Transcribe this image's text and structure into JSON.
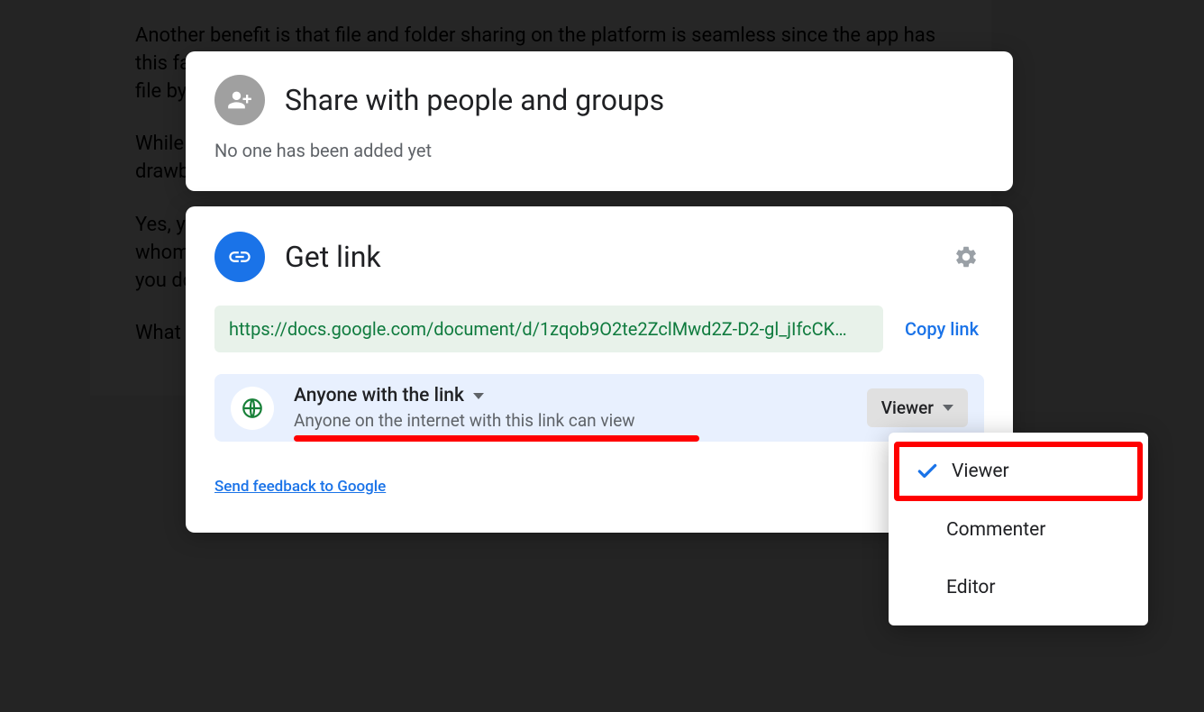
{
  "document": {
    "paragraph1": "Another benefit is that file and folder sharing on the platform is seamless since the app has this fantastic ability to",
    "paragraph1b": "file by",
    "paragraph2": "While",
    "paragraph2b": "drawb",
    "paragraph3": "Yes, you can share your Google files with anyone, but how do you protect it from those whom",
    "paragraph3b": "you dc",
    "paragraph4": "What"
  },
  "share_card": {
    "title": "Share with people and groups",
    "subtitle": "No one has been added yet"
  },
  "getlink_card": {
    "title": "Get link",
    "url": "https://docs.google.com/document/d/1zqob9O2te2ZclMwd2Z-D2-gl_jIfcCK…",
    "copy_label": "Copy link",
    "access_main": "Anyone with the link",
    "access_sub": "Anyone on the internet with this link can view",
    "role_button_label": "Viewer",
    "feedback_label": "Send feedback to Google"
  },
  "dropdown": {
    "items": [
      {
        "label": "Viewer",
        "checked": true,
        "highlighted": true
      },
      {
        "label": "Commenter",
        "checked": false,
        "highlighted": false
      },
      {
        "label": "Editor",
        "checked": false,
        "highlighted": false
      }
    ]
  }
}
